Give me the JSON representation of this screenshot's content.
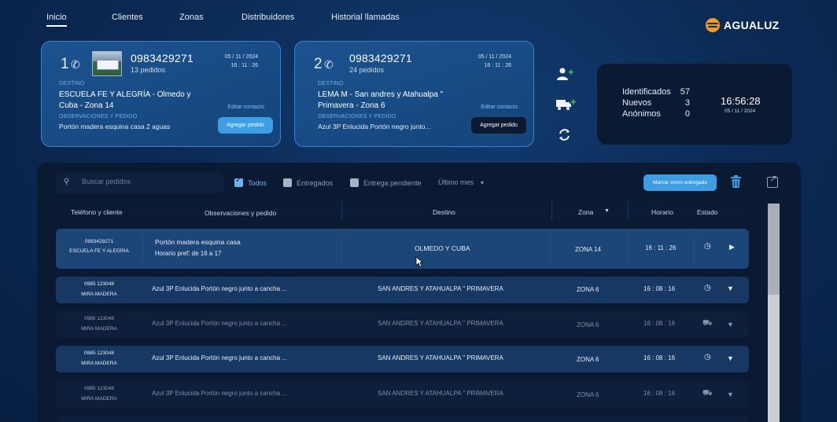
{
  "nav": {
    "items": [
      "Inicio",
      "Clientes",
      "Zonas",
      "Distribuidores",
      "Historial llamadas"
    ],
    "brand": "AGUALUZ"
  },
  "calls": [
    {
      "line": "1",
      "phone": "0983429271",
      "orders": "13 pedidos",
      "date": "05 / 11 / 2024",
      "time": "16 : 11 : 26",
      "dest_label": "DESTINO",
      "destination": "ESCUELA FE Y ALEGRÍA - Olmedo y Cuba - Zona 14",
      "obs_label": "OBSERVACIONES Y PEDIDO",
      "observation": "Portón madera esquina casa 2 aguas",
      "edit": "Editar contacto",
      "add": "Agregar pedido"
    },
    {
      "line": "2",
      "phone": "0983429271",
      "orders": "24 pedidos",
      "date": "05 / 11 / 2024",
      "time": "16 : 11 : 26",
      "dest_label": "DESTINO",
      "destination": "LEMA M - San andres y Atahualpa \" Primavera - Zona 6",
      "obs_label": "OBSERVACIONES Y PEDIDO",
      "observation": "Azul 3P Enlucida  Portón negro junto...",
      "edit": "Editar contacto",
      "add": "Agregar pedido"
    }
  ],
  "side_icons": [
    "add-user-icon",
    "add-truck-icon",
    "refresh-icon"
  ],
  "stats": {
    "identified_label": "Identificados",
    "identified": "57",
    "new_label": "Nuevos",
    "new": "3",
    "anon_label": "Anónimos",
    "anon": "0",
    "clock": "16:56:28",
    "date": "05 / 11 / 2024"
  },
  "toolbar": {
    "search_placeholder": "Buscar pedidos",
    "filters": [
      "Todos",
      "Entregados",
      "Entrega pendiente"
    ],
    "period": "Último mes",
    "mark_delivered": "Marcar como entregado"
  },
  "table": {
    "headers": [
      "Teléfono y cliente",
      "Observaciones y pedido",
      "Destino",
      "Zona",
      "Horario",
      "Estado"
    ],
    "rows": [
      {
        "phone": "0983429271",
        "client": "ESCUELA FE Y ALEGRIA",
        "obs1": "Portón madera esquina casa",
        "obs2": "Horario pref: de 16 a 17",
        "dest": "OLMEDO Y CUBA",
        "zone": "ZONA 14",
        "time": "16 : 11 : 26",
        "state_icon": "clock-icon",
        "action": "chevron-right-icon"
      },
      {
        "phone": "0985 123048",
        "client": "MIRA MADERA",
        "obs1": "Azul 3P Enlucida  Portón negro junto a cancha ...",
        "obs2": "",
        "dest": "SAN ANDRES Y ATAHUALPA \" PRIMAVERA",
        "zone": "ZONA 6",
        "time": "16 : 08 : 16",
        "state_icon": "clock-icon",
        "action": "chevron-down-icon"
      },
      {
        "phone": "0985 123048",
        "client": "MIRA MADERA",
        "obs1": "Azul 3P Enlucida  Portón negro junto a cancha ...",
        "obs2": "",
        "dest": "SAN ANDRES Y ATAHUALPA \" PRIMAVERA",
        "zone": "ZONA 6",
        "time": "16 : 08 : 16",
        "state_icon": "truck-icon",
        "action": "chevron-down-icon"
      },
      {
        "phone": "0985 123048",
        "client": "MIRA MADERA",
        "obs1": "Azul 3P Enlucida  Portón negro junto a cancha ...",
        "obs2": "",
        "dest": "SAN ANDRES Y ATAHUALPA \" PRIMAVERA",
        "zone": "ZONA 6",
        "time": "16 : 08 : 16",
        "state_icon": "clock-icon",
        "action": "chevron-down-icon"
      },
      {
        "phone": "0985 123048",
        "client": "MIRA MADERA",
        "obs1": "Azul 3P Enlucida  Portón negro junto a cancha ...",
        "obs2": "",
        "dest": "SAN ANDRES Y ATAHUALPA \" PRIMAVERA",
        "zone": "ZONA 6",
        "time": "16 : 08 : 16",
        "state_icon": "truck-icon",
        "action": "chevron-down-icon"
      }
    ]
  },
  "colors": {
    "accent": "#3d9ee3",
    "brand_orange": "#f39a1f",
    "positive": "#3ec74a"
  }
}
